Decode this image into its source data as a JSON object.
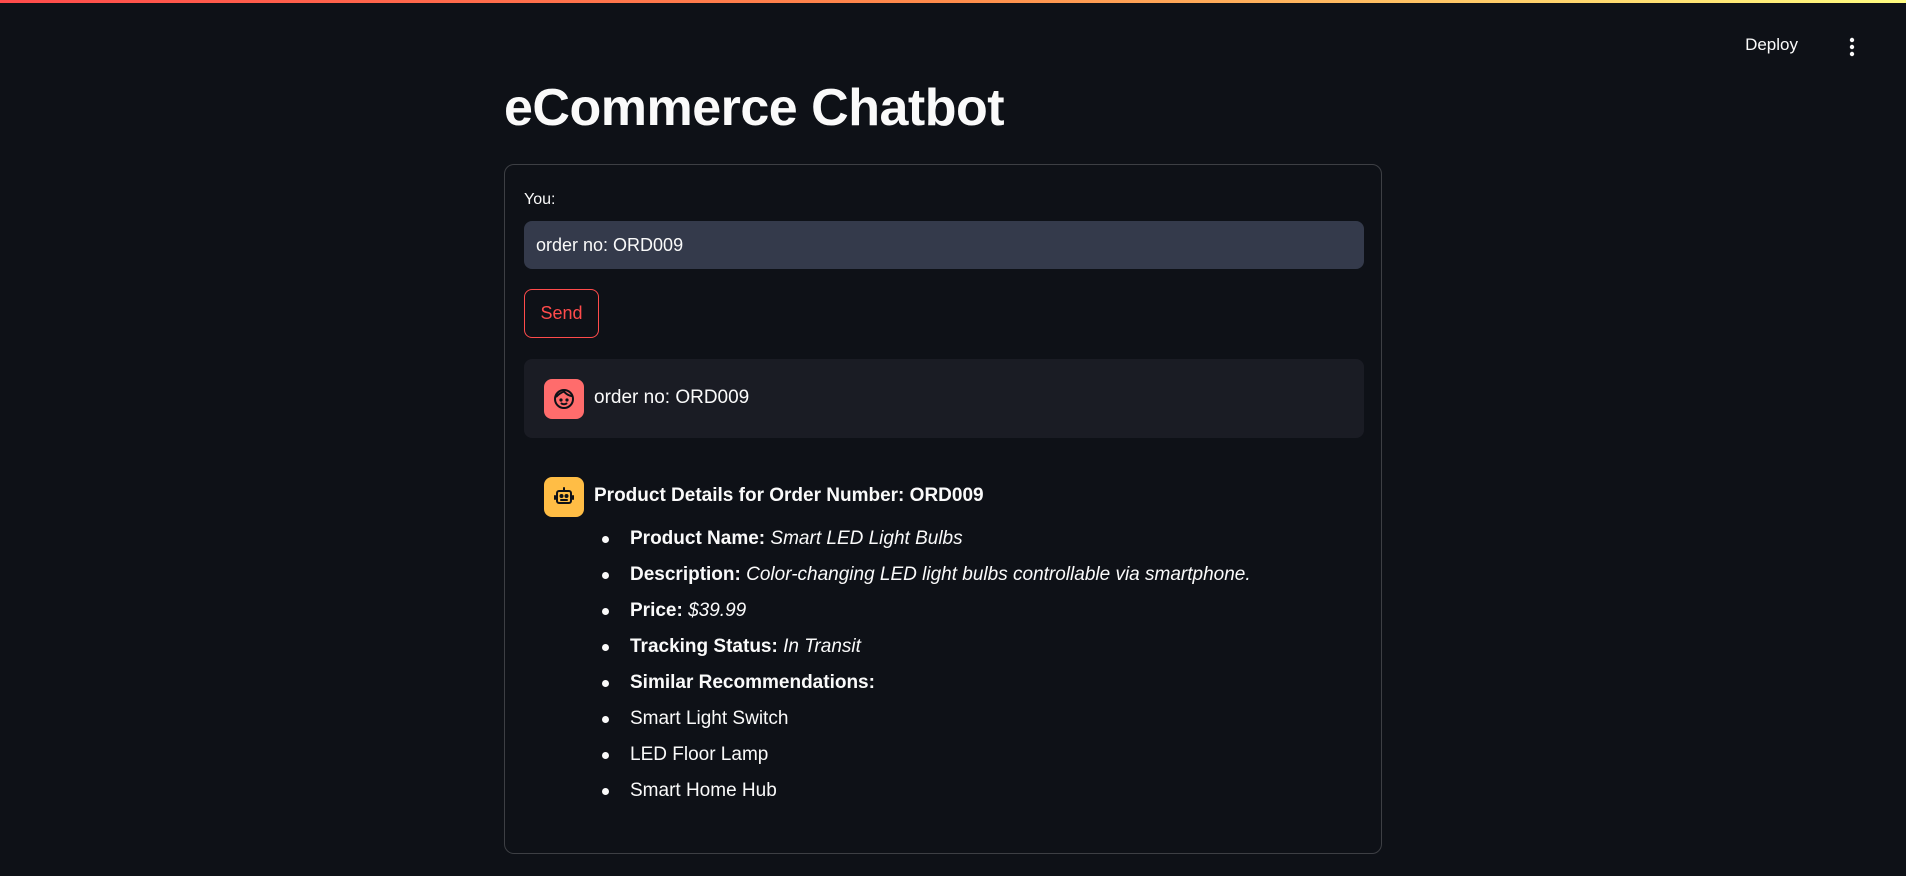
{
  "header": {
    "deploy_label": "Deploy",
    "menu_icon": "kebab-menu-icon"
  },
  "colors": {
    "background": "#0e1117",
    "accent": "#ff4b4b",
    "user_avatar": "#ff6c6c",
    "assistant_avatar": "#ffbd45",
    "input_background": "#343a4b",
    "user_message_background": "#1a1c24"
  },
  "page": {
    "title": "eCommerce Chatbot"
  },
  "form": {
    "input_label": "You:",
    "input_value": "order no: ORD009",
    "send_label": "Send"
  },
  "messages": {
    "user": {
      "avatar_icon": "user-face-icon",
      "text": "order no: ORD009"
    },
    "assistant": {
      "avatar_icon": "robot-icon",
      "heading": "Product Details for Order Number: ORD009",
      "details": [
        {
          "label": "Product Name:",
          "value": "Smart LED Light Bulbs"
        },
        {
          "label": "Description:",
          "value": "Color-changing LED light bulbs controllable via smartphone."
        },
        {
          "label": "Price:",
          "value": "$39.99"
        },
        {
          "label": "Tracking Status:",
          "value": "In Transit"
        },
        {
          "label": "Similar Recommendations:",
          "value": ""
        }
      ],
      "recommendations": [
        "Smart Light Switch",
        "LED Floor Lamp",
        "Smart Home Hub"
      ]
    }
  }
}
